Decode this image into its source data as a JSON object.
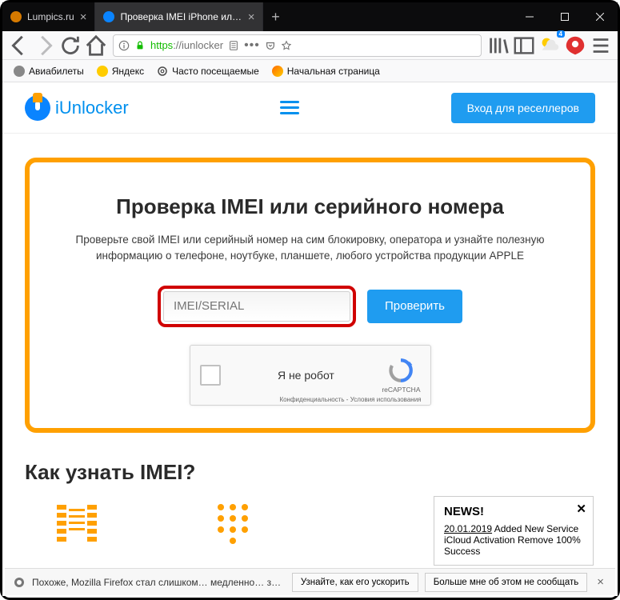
{
  "titlebar": {
    "tabs": [
      {
        "title": "Lumpics.ru",
        "favicon": "#d67a00",
        "active": false
      },
      {
        "title": "Проверка IMEI iPhone или Ser",
        "favicon": "#0a84ff",
        "active": true
      }
    ]
  },
  "navbar": {
    "url_prefix": "https",
    "url_domain": "://iunlocker"
  },
  "bookmarks": {
    "items": [
      {
        "label": "Авиабилеты",
        "color": "#888"
      },
      {
        "label": "Яндекс",
        "color": "#ffcc00"
      },
      {
        "label": "Часто посещаемые",
        "color": "#4a4a4a"
      },
      {
        "label": "Начальная страница",
        "color": "#ff6a00"
      }
    ]
  },
  "weather_badge": "4",
  "site": {
    "logo_text": "iUnlocker",
    "reseller_btn": "Вход для реселлеров"
  },
  "hero": {
    "title": "Проверка IMEI или серийного номера",
    "subtitle": "Проверьте свой IMEI или серийный номер на сим блокировку, оператора и узнайте полезную информацию о телефоне, ноутбуке, планшете, любого устройства продукции APPLE",
    "input_placeholder": "IMEI/SERIAL",
    "check_btn": "Проверить"
  },
  "captcha": {
    "label": "Я не робот",
    "brand": "reCAPTCHA",
    "links": "Конфиденциальность - Условия использования"
  },
  "section2": {
    "title": "Как узнать IMEI?"
  },
  "news": {
    "heading": "NEWS!",
    "date": "20.01.2019",
    "body": " Added New Service iCloud Activation Remove 100% Success"
  },
  "bottombar": {
    "message": "Похоже, Mozilla Firefox стал слишком… медленно… запускаться…",
    "btn1": "Узнайте, как его ускорить",
    "btn2": "Больше мне об этом не сообщать"
  }
}
